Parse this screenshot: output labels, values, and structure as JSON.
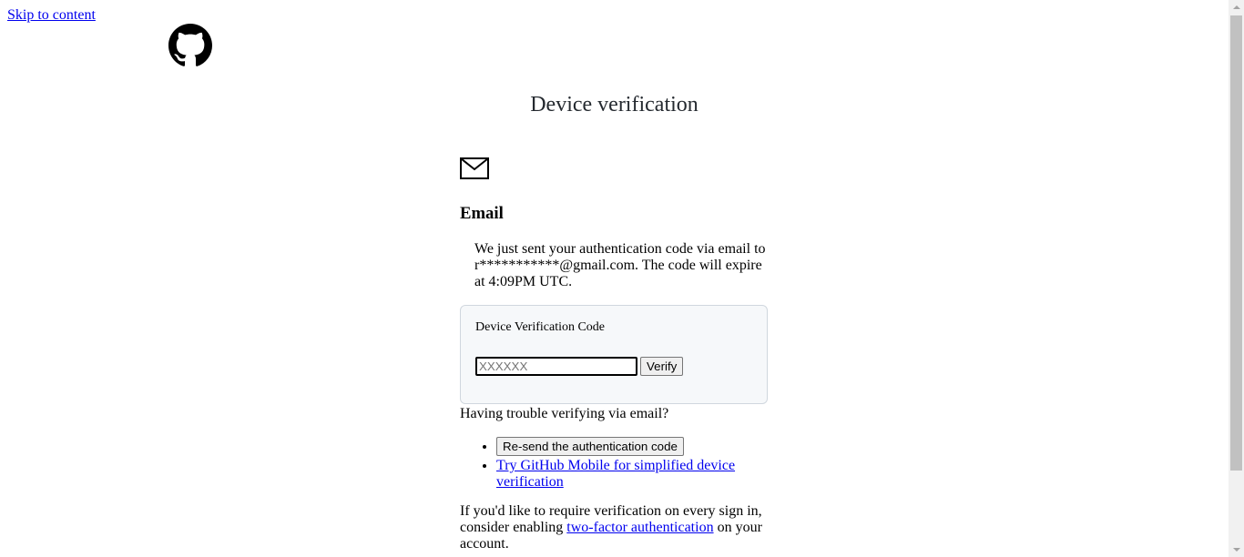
{
  "skip_link": "Skip to content",
  "logo": {
    "icon": "github-logo-icon"
  },
  "page": {
    "title": "Device verification"
  },
  "method": {
    "icon": "mail-icon",
    "heading": "Email",
    "message": "We just sent your authentication code via email to r***********@gmail.com. The code will expire at 4:09PM UTC."
  },
  "form": {
    "label": "Device Verification Code",
    "placeholder": "XXXXXX",
    "value": "",
    "verify_label": "Verify"
  },
  "trouble": {
    "text": "Having trouble verifying via email?",
    "resend_label": "Re-send the authentication code",
    "mobile_link": "Try GitHub Mobile for simplified device verification"
  },
  "twofa": {
    "prefix": "If you'd like to require verification on every sign in, consider enabling ",
    "link": "two-factor authentication",
    "suffix": " on your account."
  },
  "colors": {
    "link": "#0000ee",
    "box_background": "#f6f8fa",
    "box_border": "#d0d7de"
  }
}
